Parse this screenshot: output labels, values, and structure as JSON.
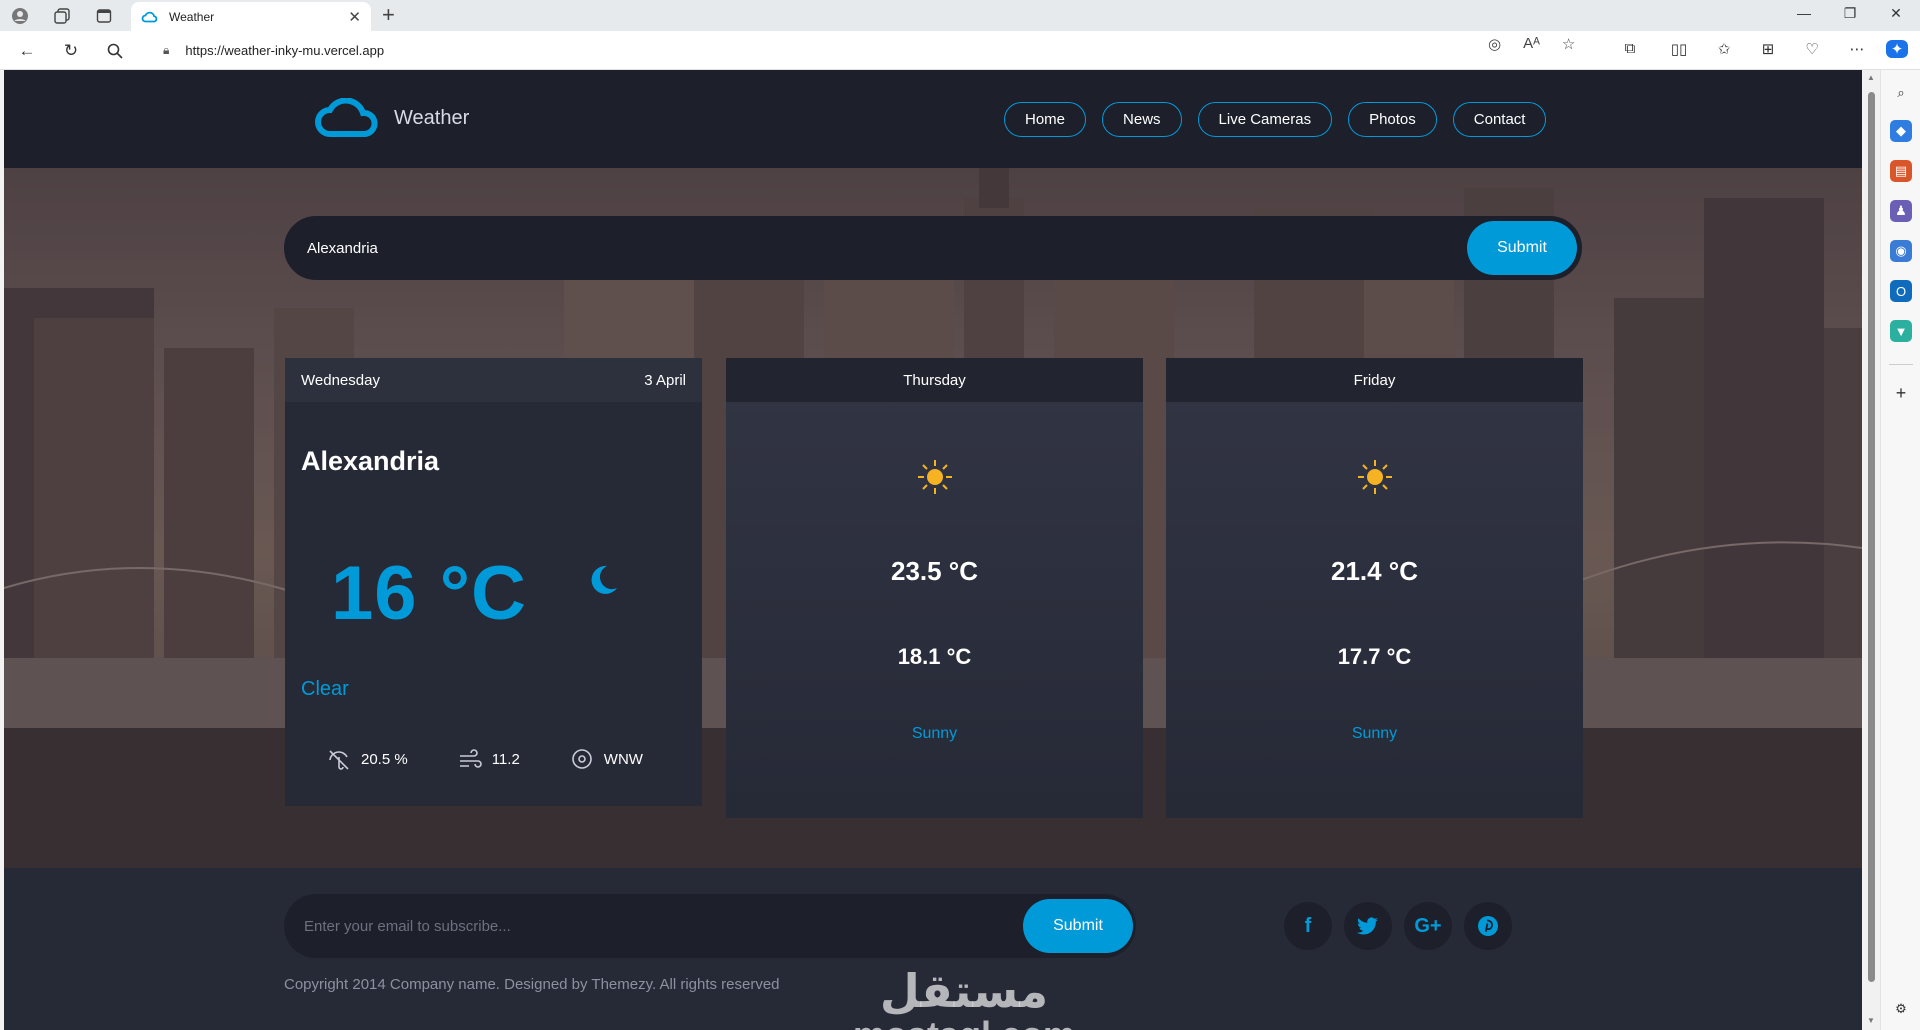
{
  "browser": {
    "tab_title": "Weather",
    "url": "https://weather-inky-mu.vercel.app"
  },
  "site": {
    "logo_text": "Weather",
    "nav": [
      {
        "label": "Home"
      },
      {
        "label": "News"
      },
      {
        "label": "Live Cameras"
      },
      {
        "label": "Photos"
      },
      {
        "label": "Contact"
      }
    ]
  },
  "search": {
    "value": "Alexandria",
    "button": "Submit"
  },
  "today": {
    "day": "Wednesday",
    "date": "3 April",
    "city": "Alexandria",
    "temp": "16 °C",
    "condition": "Clear",
    "humidity": "20.5 %",
    "wind": "11.2",
    "direction": "WNW",
    "icon": "moon-icon"
  },
  "forecast": [
    {
      "day": "Thursday",
      "max": "23.5 °C",
      "min": "18.1 °C",
      "condition": "Sunny",
      "icon": "sun-icon"
    },
    {
      "day": "Friday",
      "max": "21.4 °C",
      "min": "17.7 °C",
      "condition": "Sunny",
      "icon": "sun-icon"
    }
  ],
  "footer": {
    "subscribe_placeholder": "Enter your email to subscribe...",
    "subscribe_button": "Submit",
    "copyright": "Copyright 2014 Company name. Designed by Themezy. All rights reserved",
    "socials": [
      "facebook-icon",
      "twitter-icon",
      "google-plus-icon",
      "pinterest-icon"
    ]
  },
  "watermark": {
    "arabic": "مستقل",
    "latin": "mostaql.com"
  },
  "colors": {
    "accent": "#009ad8",
    "dark": "#1d1f2b",
    "card": "#262936"
  }
}
